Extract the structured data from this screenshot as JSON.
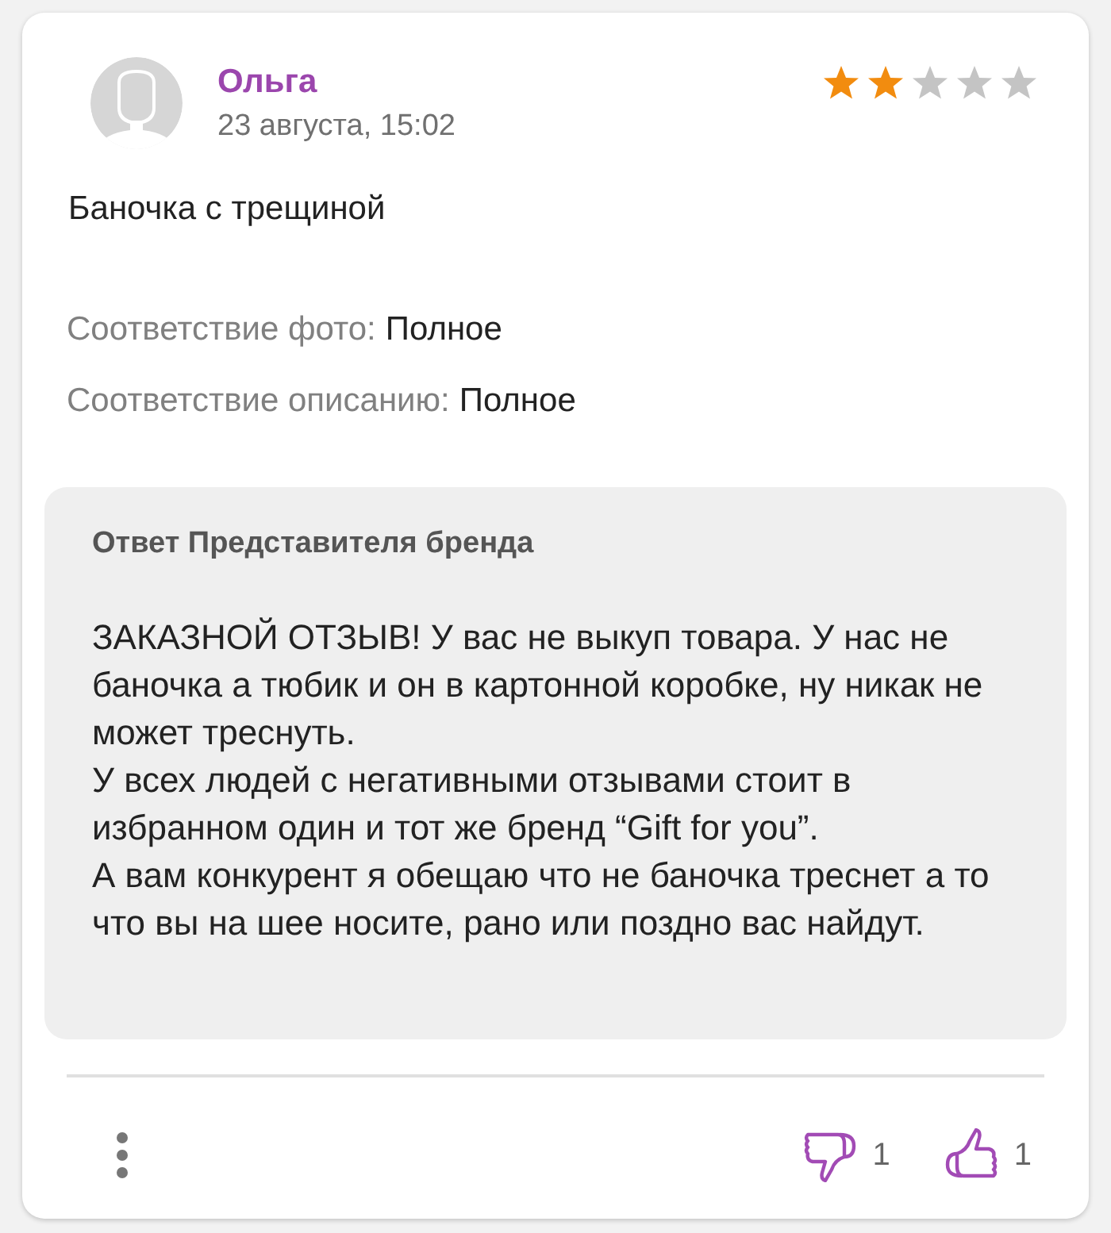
{
  "review": {
    "author": "Ольга",
    "date": "23 августа, 15:02",
    "stars": 2,
    "text": "Баночка с трещиной",
    "attributes": [
      {
        "label": "Соответствие фото:",
        "value": "Полное"
      },
      {
        "label": "Соответствие описанию:",
        "value": "Полное"
      }
    ]
  },
  "brand_reply": {
    "title": "Ответ Представителя бренда",
    "paragraphs": [
      "ЗАКАЗНОЙ ОТЗЫВ! У вас не выкуп товара. У нас не баночка а тюбик и он в картонной коробке, ну никак не может треснуть.",
      "У всех людей с негативными отзывами стоит в избранном один и тот же бренд “Gift for you”.",
      "А вам конкурент я обещаю что не баночка треснет а то что вы на шее носите, рано или поздно вас найдут."
    ]
  },
  "footer": {
    "dislikes": "1",
    "likes": "1"
  }
}
